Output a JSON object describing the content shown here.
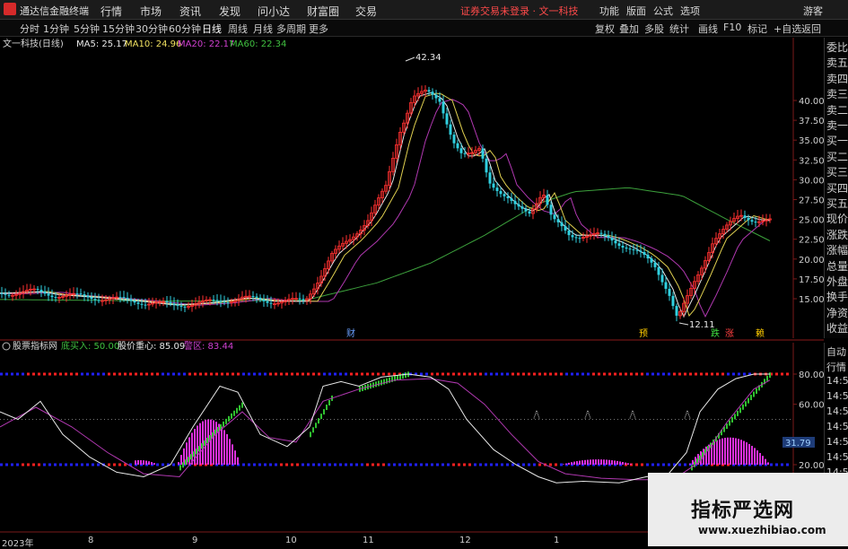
{
  "titlebar": {
    "app_name": "通达信金融终端",
    "menus": [
      "行情",
      "市场",
      "资讯",
      "发现",
      "问小达",
      "财富圈",
      "交易"
    ],
    "notice": "证券交易未登录 · 文一科技",
    "right_menus": [
      "功能",
      "版面",
      "公式",
      "选项",
      "游客"
    ]
  },
  "toolbar": {
    "timeframes": [
      "分时",
      "1分钟",
      "5分钟",
      "15分钟",
      "30分钟",
      "60分钟",
      "日线",
      "周线",
      "月线",
      "多周期",
      "更多"
    ],
    "active_timeframe": "日线",
    "right_buttons": [
      "复权",
      "叠加",
      "多股",
      "统计",
      "画线",
      "F10",
      "标记",
      "+自选",
      "返回"
    ]
  },
  "main_chart": {
    "stock_label": "文一科技(日线)",
    "ma": [
      {
        "label": "MA5: 25.17",
        "color": "#e8e8e8"
      },
      {
        "label": "MA10: 24.96",
        "color": "#f0e060"
      },
      {
        "label": "MA20: 22.17",
        "color": "#d040d0"
      },
      {
        "label": "MA60: 22.34",
        "color": "#40c040"
      }
    ],
    "y_ticks": [
      {
        "value": 40,
        "label": "40.00"
      },
      {
        "value": 37.5,
        "label": "37.50"
      },
      {
        "value": 35,
        "label": "35.00"
      },
      {
        "value": 32.5,
        "label": "32.50"
      },
      {
        "value": 30,
        "label": "30.00"
      },
      {
        "value": 27.5,
        "label": "27.50"
      },
      {
        "value": 25,
        "label": "25.00"
      },
      {
        "value": 22.5,
        "label": "22.50"
      },
      {
        "value": 20,
        "label": "20.00"
      },
      {
        "value": 17.5,
        "label": "17.50"
      },
      {
        "value": 15,
        "label": "15.00"
      }
    ],
    "high_label": "42.34",
    "low_label": "12.11",
    "markers": [
      {
        "text": "财",
        "color": "#6aa0ff"
      },
      {
        "text": "预",
        "color": "#ffcc00"
      },
      {
        "text": "跌",
        "color": "#40e040"
      },
      {
        "text": "涨",
        "color": "#ff4040"
      },
      {
        "text": "赖",
        "color": "#ffcc00"
      }
    ]
  },
  "indicator": {
    "name": "股票指标网",
    "items": [
      {
        "label": "底买入: 50.00",
        "color": "#40c040"
      },
      {
        "label": "股价重心: 85.09",
        "color": "#e8e8e8"
      },
      {
        "label": "警区: 83.44",
        "color": "#d040d0"
      }
    ],
    "y_ticks": [
      {
        "value": 80,
        "label": "80.00"
      },
      {
        "value": 60,
        "label": "60.00"
      },
      {
        "value": 20,
        "label": "20.00"
      }
    ],
    "badge": "31.79"
  },
  "quote_panel": [
    "委比",
    "卖五",
    "卖四",
    "卖三",
    "卖二",
    "卖一",
    "买一",
    "买二",
    "买三",
    "买四",
    "买五",
    "现价",
    "涨跌",
    "涨幅",
    "总量",
    "外盘",
    "换手",
    "净资",
    "收益"
  ],
  "right_tabs": [
    "自动",
    "行情",
    "14:5",
    "14:5",
    "14:5",
    "14:5",
    "14:5",
    "14:5",
    "14:5",
    "14:5"
  ],
  "x_axis": [
    "2023年",
    "8",
    "9",
    "10",
    "11",
    "12",
    "1"
  ],
  "watermark": {
    "title": "指标严选网",
    "url": "www.xuezhibiao.com"
  }
}
